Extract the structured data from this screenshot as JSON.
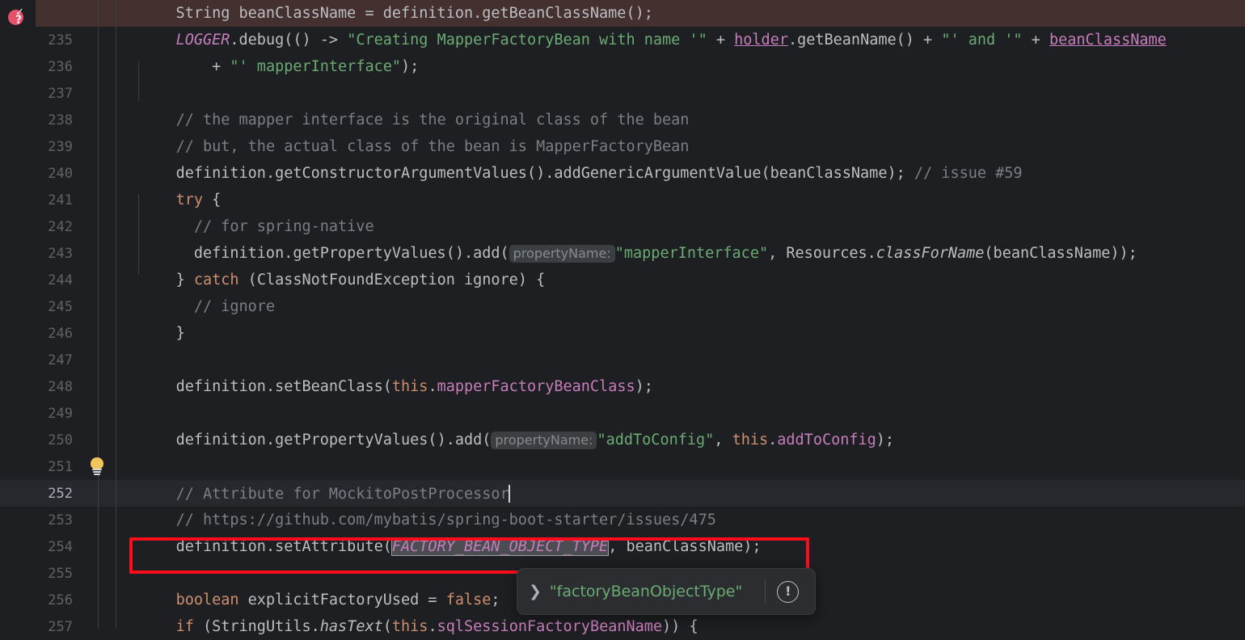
{
  "editor": {
    "background_color": "#1e1f22",
    "error_line_bg": "#43302f",
    "caret_line_bg": "#26282e",
    "inspection_widget": {
      "name": "inspections-widget",
      "check_glyph": "✓",
      "question_glyph": "?",
      "color": "#e8516a"
    },
    "intention_bulb": {
      "name": "intention-bulb",
      "line": "251"
    },
    "caret_line": "252",
    "annotation_box_color": "#fc0d1b"
  },
  "line_numbers": [
    "",
    "235",
    "236",
    "237",
    "238",
    "239",
    "240",
    "241",
    "242",
    "243",
    "244",
    "245",
    "246",
    "247",
    "248",
    "249",
    "250",
    "251",
    "252",
    "253",
    "254",
    "255",
    "256",
    "257"
  ],
  "lines": {
    "l234": {
      "text": "    String beanClassName = definition.getBeanClassName();"
    },
    "l235": {
      "logger": "LOGGER",
      "dot_debug": ".debug(() -> ",
      "str1": "\"Creating MapperFactoryBean with name '\"",
      "plus1": " + ",
      "holder": "holder",
      "getbeanname": ".getBeanName()",
      "plus2": " + ",
      "str2": "\"' and '\"",
      "plus3": " + ",
      "beanclassname": "beanClassName"
    },
    "l236": {
      "plus": "+ ",
      "str": "\"' mapperInterface\"",
      "tail": ");"
    },
    "l238": {
      "comment": "// the mapper interface is the original class of the bean"
    },
    "l239": {
      "comment": "// but, the actual class of the bean is MapperFactoryBean"
    },
    "l240": {
      "code": "definition.getConstructorArgumentValues().addGenericArgumentValue(beanClassName);",
      "comment": " // issue #59"
    },
    "l241": {
      "kw": "try",
      "tail": " {"
    },
    "l242": {
      "comment": "// for spring-native"
    },
    "l243": {
      "pre": "definition.getPropertyValues().add(",
      "hint": "propertyName:",
      "str": "\"mapperInterface\"",
      "mid": ", Resources.",
      "method": "classForName",
      "tail": "(beanClassName));"
    },
    "l244": {
      "pre": "} ",
      "kw": "catch",
      "tail": " (ClassNotFoundException ignore) {"
    },
    "l245": {
      "comment": "// ignore"
    },
    "l246": {
      "text": "}"
    },
    "l248": {
      "pre": "definition.setBeanClass(",
      "kw": "this",
      "dot": ".",
      "field": "mapperFactoryBeanClass",
      "tail": ");"
    },
    "l250": {
      "pre": "definition.getPropertyValues().add(",
      "hint": "propertyName:",
      "str": "\"addToConfig\"",
      "mid": ", ",
      "kw": "this",
      "dot": ".",
      "field": "addToConfig",
      "tail": ");"
    },
    "l252": {
      "comment": "// Attribute for MockitoPostProcessor"
    },
    "l253": {
      "comment": "// https://github.com/mybatis/spring-boot-starter/issues/475"
    },
    "l254": {
      "pre": "definition.setAttribute(",
      "constant": "FACTORY_BEAN_OBJECT_TYPE",
      "tail": ", beanClassName);"
    },
    "l256": {
      "kw": "boolean",
      "mid": " explicitFactoryUsed = ",
      "kw2": "false",
      "tail": ";"
    },
    "l257": {
      "kw": "if",
      "mid": " (StringUtils.",
      "method": "hasText",
      "mid2": "(",
      "kw2": "this",
      "dot": ".",
      "field": "sqlSessionFactoryBeanName",
      "tail": ")) {"
    }
  },
  "tooltip": {
    "chevron": "❯",
    "value": "\"factoryBeanObjectType\"",
    "warn_glyph": "!"
  }
}
